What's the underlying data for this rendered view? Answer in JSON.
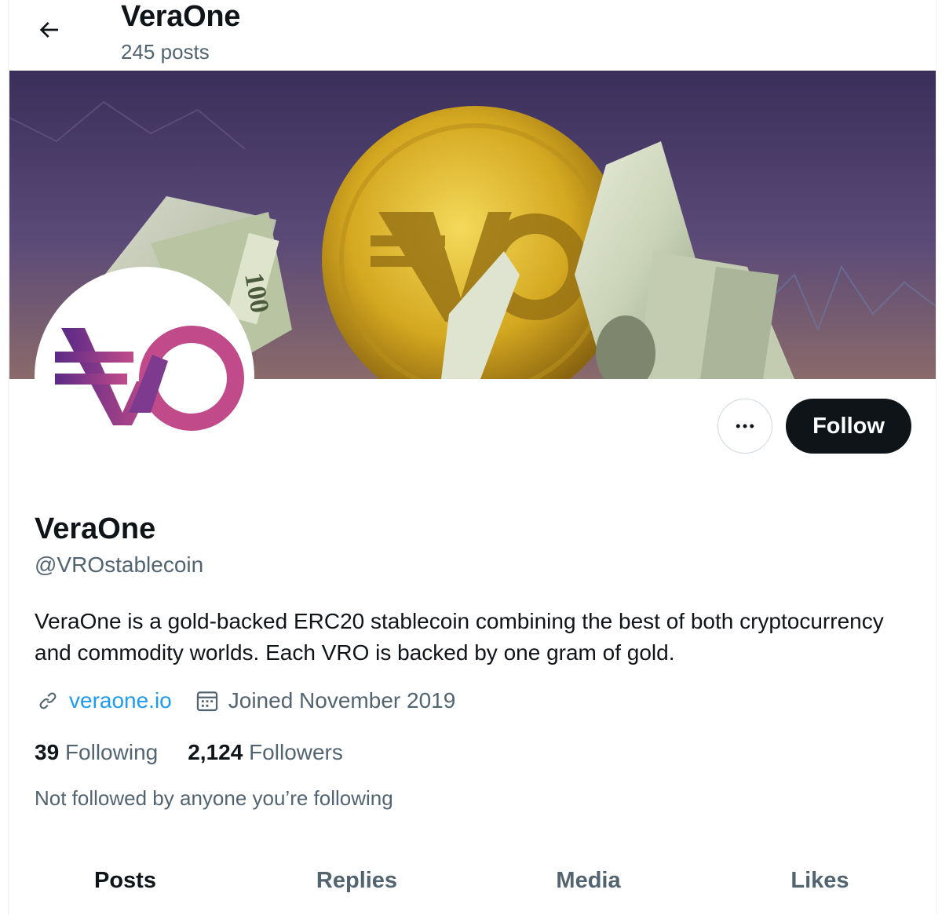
{
  "header": {
    "back_icon": "arrow-left-icon",
    "title": "VeraOne",
    "posts_count": "245 posts"
  },
  "banner": {
    "description_icon": "gold-coin-banknotes-banner"
  },
  "avatar": {
    "logo_text": "VO",
    "colors": {
      "purple": "#5b2a86",
      "pink": "#c14b8a"
    }
  },
  "actions": {
    "more_icon": "more-horizontal-icon",
    "follow_label": "Follow"
  },
  "profile": {
    "display_name": "VeraOne",
    "handle": "@VROstablecoin",
    "bio": "VeraOne is a gold-backed ERC20 stablecoin combining the best of both cryptocurrency and commodity worlds. Each VRO is backed by one gram of gold.",
    "website": "veraone.io",
    "website_icon": "link-icon",
    "joined": "Joined November 2019",
    "joined_icon": "calendar-icon",
    "following_count": "39",
    "following_label": "Following",
    "followers_count": "2,124",
    "followers_label": "Followers",
    "not_followed": "Not followed by anyone you’re following"
  },
  "tabs": [
    {
      "label": "Posts",
      "active": true
    },
    {
      "label": "Replies",
      "active": false
    },
    {
      "label": "Media",
      "active": false
    },
    {
      "label": "Likes",
      "active": false
    }
  ],
  "colors": {
    "text_primary": "#0f1419",
    "text_secondary": "#536471",
    "link": "#1d9bf0",
    "follow_bg": "#0f1419"
  }
}
